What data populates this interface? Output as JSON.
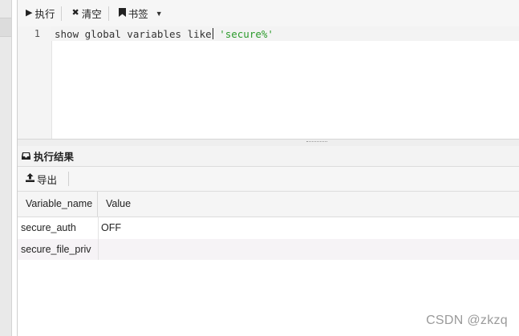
{
  "toolbar": {
    "execute_label": "执行",
    "clear_label": "清空",
    "bookmark_label": "书签"
  },
  "editor": {
    "line_number": "1",
    "code_plain": "show global variables like",
    "code_string": "'secure%'"
  },
  "results": {
    "title": "执行结果",
    "export_label": "导出",
    "columns": [
      "Variable_name",
      "Value"
    ],
    "rows": [
      [
        "secure_auth",
        "OFF"
      ],
      [
        "secure_file_priv",
        ""
      ]
    ]
  },
  "watermark": "CSDN @zkzq",
  "icons": {
    "execute": "play-icon",
    "clear": "close-icon",
    "bookmark": "bookmark-icon",
    "dropdown": "chevron-down-icon",
    "results": "inbox-icon",
    "export": "upload-icon"
  }
}
